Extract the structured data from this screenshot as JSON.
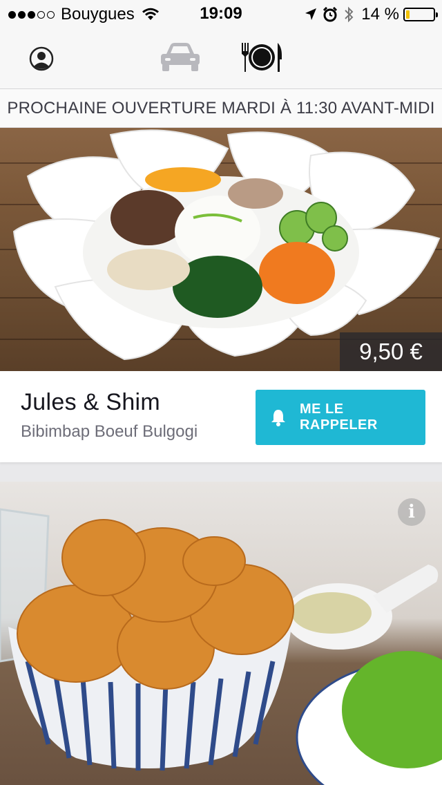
{
  "status_bar": {
    "carrier": "Bouygues",
    "time": "19:09",
    "battery_percent_label": "14 %",
    "battery_level": 0.14,
    "signal_bars": 3,
    "battery_color": "#f2c200"
  },
  "top_nav": {
    "icons": [
      "profile-icon",
      "car-icon",
      "cutlery-plate-icon"
    ],
    "active": "cutlery-plate-icon"
  },
  "banner": {
    "text": "PROCHAINE OUVERTURE MARDI À 11:30 AVANT-MIDI"
  },
  "cards": [
    {
      "price": "9,50 €",
      "restaurant": "Jules & Shim",
      "dish": "Bibimbap Boeuf Bulgogi",
      "button_label": "ME LE RAPPELER",
      "button_icon": "bell-icon",
      "button_color": "#1fb8d4"
    },
    {
      "info_icon_label": "i"
    }
  ]
}
